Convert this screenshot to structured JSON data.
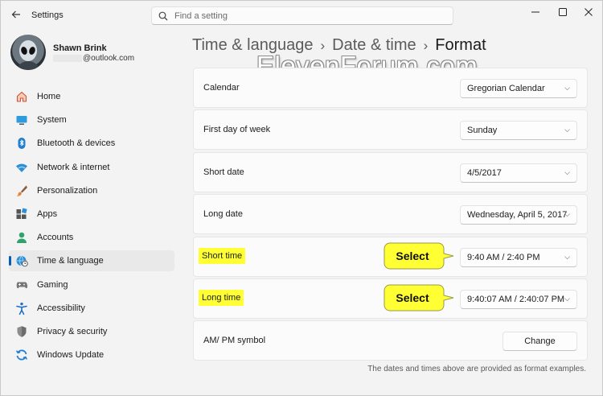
{
  "app": {
    "title": "Settings"
  },
  "search": {
    "placeholder": "Find a setting"
  },
  "profile": {
    "name": "Shawn Brink",
    "email": "@outlook.com"
  },
  "nav": {
    "items": [
      {
        "label": "Home",
        "icon": "home-icon"
      },
      {
        "label": "System",
        "icon": "monitor-icon"
      },
      {
        "label": "Bluetooth & devices",
        "icon": "bluetooth-icon"
      },
      {
        "label": "Network & internet",
        "icon": "wifi-icon"
      },
      {
        "label": "Personalization",
        "icon": "brush-icon"
      },
      {
        "label": "Apps",
        "icon": "apps-icon"
      },
      {
        "label": "Accounts",
        "icon": "person-icon"
      },
      {
        "label": "Time & language",
        "icon": "globe-clock-icon"
      },
      {
        "label": "Gaming",
        "icon": "gamepad-icon"
      },
      {
        "label": "Accessibility",
        "icon": "accessibility-icon"
      },
      {
        "label": "Privacy & security",
        "icon": "shield-icon"
      },
      {
        "label": "Windows Update",
        "icon": "update-icon"
      }
    ]
  },
  "breadcrumb": {
    "part1": "Time & language",
    "part2": "Date & time",
    "current": "Format",
    "separator": "›"
  },
  "watermark": "ElevenForum.com",
  "rows": {
    "calendar": {
      "label": "Calendar",
      "value": "Gregorian Calendar"
    },
    "first_day": {
      "label": "First day of week",
      "value": "Sunday"
    },
    "short_date": {
      "label": "Short date",
      "value": "4/5/2017"
    },
    "long_date": {
      "label": "Long date",
      "value": "Wednesday, April 5, 2017"
    },
    "short_time": {
      "label": "Short time",
      "value": "9:40 AM / 2:40 PM",
      "callout": "Select"
    },
    "long_time": {
      "label": "Long time",
      "value": "9:40:07 AM / 2:40:07 PM",
      "callout": "Select"
    },
    "ampm": {
      "label": "AM/ PM symbol",
      "button": "Change"
    }
  },
  "footnote": "The dates and times above are provided as format examples.",
  "colors": {
    "accent": "#005fb8",
    "highlight": "#ffff33",
    "callout_fill": "#ffff33"
  }
}
